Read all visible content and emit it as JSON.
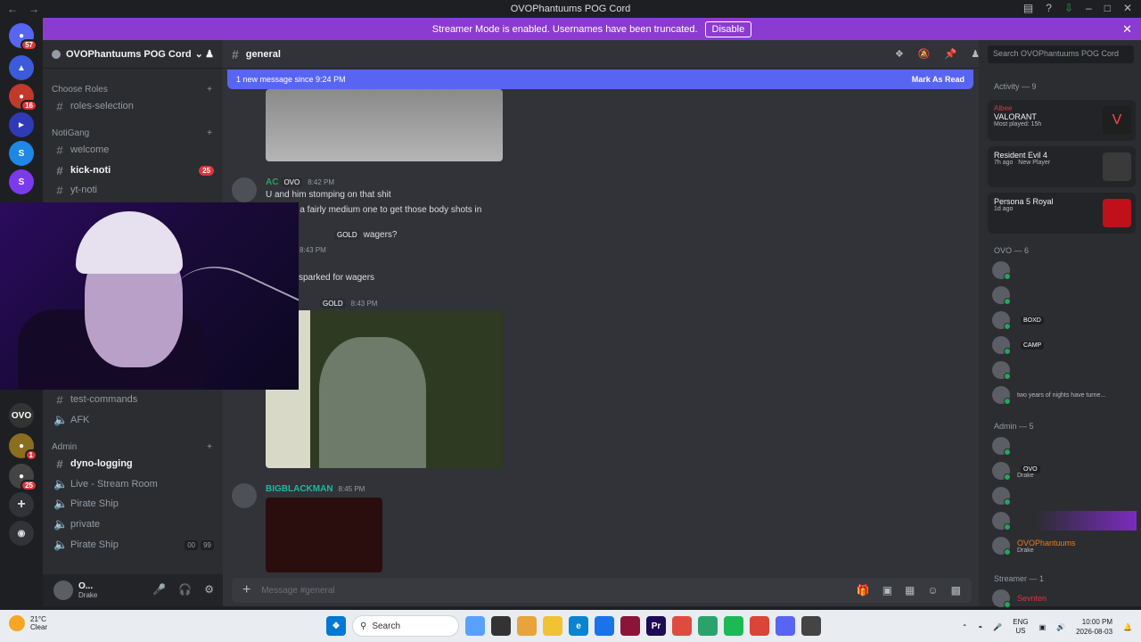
{
  "window": {
    "title": "OVOPhantuums POG Cord"
  },
  "banner": {
    "text": "Streamer Mode is enabled. Usernames have been truncated.",
    "button": "Disable"
  },
  "servers": [
    {
      "badge": "57",
      "color": "#5865f2"
    },
    {
      "badge": "",
      "color": "#3b5bdb"
    },
    {
      "badge": "16",
      "color": "#c0392b"
    },
    {
      "badge": "",
      "color": "#2f3ab7"
    },
    {
      "badge": "",
      "color": "#1e88e5"
    },
    {
      "badge": "",
      "color": "#7c3aed"
    }
  ],
  "servers_bottom": [
    {
      "label": "OVO",
      "badge": "",
      "color": "#333"
    },
    {
      "label": "",
      "badge": "1",
      "color": "#8a6d1f"
    },
    {
      "label": "",
      "badge": "25",
      "color": "#444"
    }
  ],
  "guild": {
    "name": "OVOPhantuums POG Cord"
  },
  "categories": [
    {
      "name": "Choose Roles"
    },
    {
      "name": "NotiGang"
    },
    {
      "name": "Admin"
    }
  ],
  "channels": [
    {
      "name": "roles-selection",
      "icon": "hash"
    },
    {
      "name": "welcome",
      "icon": "hash"
    },
    {
      "name": "kick-noti",
      "icon": "hash",
      "badge": "25"
    },
    {
      "name": "yt-noti",
      "icon": "hash"
    },
    {
      "name": "test-commands",
      "icon": "hash"
    },
    {
      "name": "AFK",
      "icon": "speaker"
    },
    {
      "name": "dyno-logging",
      "icon": "hash"
    },
    {
      "name": "Live - Stream Room",
      "icon": "speaker"
    },
    {
      "name": "Pirate Ship",
      "icon": "speaker"
    },
    {
      "name": "private",
      "icon": "speaker"
    },
    {
      "name": "Pirate Ship",
      "icon": "speaker",
      "counts": [
        "00",
        "99"
      ]
    }
  ],
  "user": {
    "name": "O...",
    "status": "Drake"
  },
  "channel": {
    "name": "general",
    "search_placeholder": "Search OVOPhantuums POG Cord"
  },
  "newbar": {
    "text": "1 new message since 9:24 PM",
    "action": "Mark As Read"
  },
  "messages": [
    {
      "author": "AC",
      "tag": "OVO",
      "time": "8:42 PM",
      "color": "#23a55a",
      "lines": [
        "U and him stomping on that shit",
        "ly it was a fairly medium one to get those body shots in"
      ]
    },
    {
      "tag": "GOLD",
      "text": "wagers?",
      "time": "8:43 PM"
    },
    {
      "text": "sparked for wagers"
    },
    {
      "tag": "GOLD",
      "time": "8:43 PM"
    },
    {
      "author": "BIGBLACKMAN",
      "time": "8:45 PM",
      "color": "#1abc9c"
    }
  ],
  "composer": {
    "placeholder": "Message #general"
  },
  "activity": {
    "header": "Activity — 9",
    "cards": [
      {
        "user": "Albee",
        "game": "VALORANT",
        "status": "Most played: 15h"
      },
      {
        "user": "",
        "game": "Resident Evil 4",
        "status": "7h ago",
        "status2": "New Player"
      },
      {
        "user": "",
        "game": "Persona 5 Royal",
        "status": "1d ago"
      }
    ]
  },
  "member_groups": [
    {
      "name": "OVO — 6"
    },
    {
      "name": "Admin — 5"
    },
    {
      "name": "Streamer — 1"
    }
  ],
  "members_ovo": [
    {
      "name": "",
      "tag": "",
      "sub": ""
    },
    {
      "name": "",
      "tag": "",
      "sub": ""
    },
    {
      "name": "",
      "tag": "BOXD",
      "sub": ""
    },
    {
      "name": "",
      "tag": "CAMP",
      "sub": ""
    },
    {
      "name": "",
      "tag": "",
      "sub": ""
    },
    {
      "name": "",
      "tag": "",
      "sub": "two years of nights have turne..."
    }
  ],
  "members_admin": [
    {
      "name": "",
      "tag": "",
      "sub": ""
    },
    {
      "name": "",
      "tag": "OVO",
      "sub": "Drake"
    },
    {
      "name": "",
      "tag": "",
      "sub": ""
    },
    {
      "name": "",
      "tag": "",
      "sub": ""
    },
    {
      "name": "OVOPhantuums",
      "tag": "",
      "sub": "Drake"
    }
  ],
  "members_streamer": [
    {
      "name": "Sevnten"
    }
  ],
  "taskbar": {
    "temp": "21°C",
    "weather": "Clear",
    "search": "Search",
    "lang": "ENG",
    "region": "US",
    "time": "10:00 PM",
    "date": "2026-08-03"
  }
}
